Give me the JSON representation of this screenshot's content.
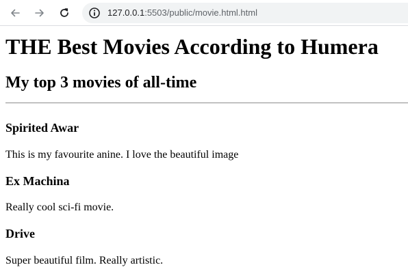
{
  "browser": {
    "url_host": "127.0.0.1",
    "url_rest": ":5503/public/movie.html.html",
    "icons": {
      "back": "arrow-left-icon",
      "forward": "arrow-right-icon",
      "reload": "reload-icon",
      "site_info": "info-icon"
    }
  },
  "page": {
    "heading": "THE Best Movies According to Humera",
    "subheading": "My top 3 movies of all-time",
    "movies": [
      {
        "title": "Spirited Awar",
        "description": "This is my favourite anine. I love the beautiful image"
      },
      {
        "title": "Ex Machina",
        "description": "Really cool sci-fi movie."
      },
      {
        "title": "Drive",
        "description": "Super beautiful film. Really artistic."
      }
    ]
  }
}
